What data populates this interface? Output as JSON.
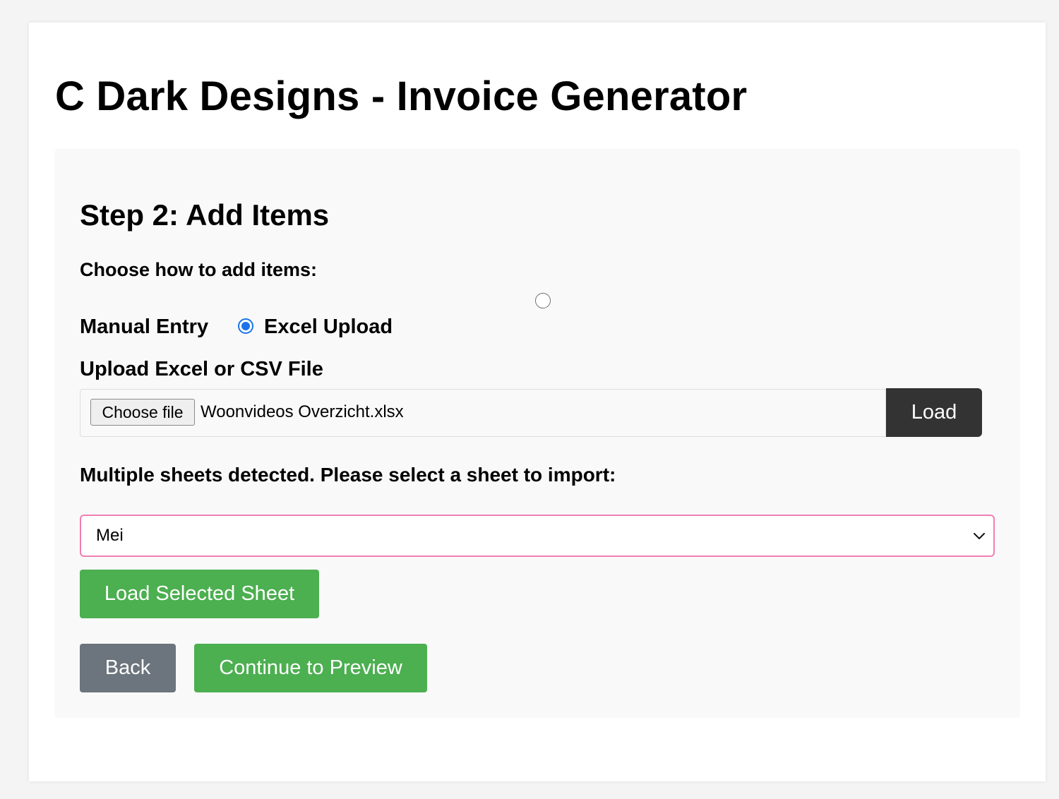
{
  "app": {
    "title": "C Dark Designs - Invoice Generator"
  },
  "step": {
    "title": "Step 2: Add Items",
    "choose_label": "Choose how to add items:",
    "options": [
      {
        "label": "Manual Entry",
        "checked": false
      },
      {
        "label": "Excel Upload",
        "checked": true
      }
    ]
  },
  "upload": {
    "label": "Upload Excel or CSV File",
    "choose_button": "Choose file",
    "file_name": "Woonvideos Overzicht.xlsx",
    "load_button": "Load"
  },
  "sheets": {
    "label": "Multiple sheets detected. Please select a sheet to import:",
    "selected": "Mei",
    "load_button": "Load Selected Sheet"
  },
  "nav": {
    "back": "Back",
    "continue": "Continue to Preview"
  },
  "colors": {
    "primary_green": "#4caf50",
    "dark_button": "#333333",
    "back_gray": "#6c757d",
    "radio_blue": "#1a73e8",
    "select_focus_pink": "#f07fb3"
  }
}
